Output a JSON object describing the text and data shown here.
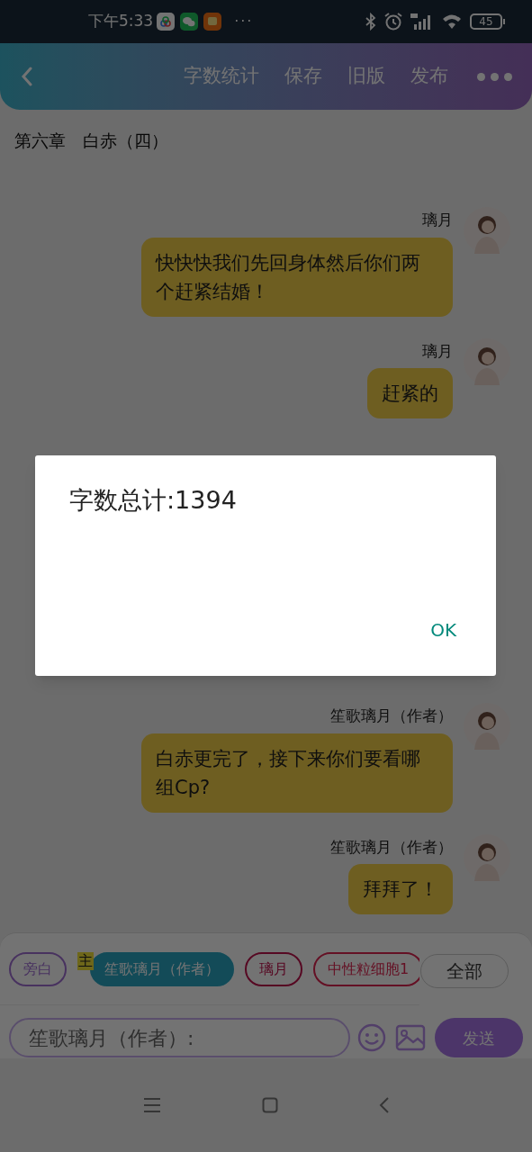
{
  "status_bar": {
    "time": "下午5:33",
    "more": "···",
    "battery": "45"
  },
  "header": {
    "actions": [
      {
        "label": "字数统计"
      },
      {
        "label": "保存"
      },
      {
        "label": "旧版"
      },
      {
        "label": "发布"
      }
    ]
  },
  "chapter_title": "第六章　白赤（四）",
  "messages": [
    {
      "sender": "璃月",
      "text": "快快快我们先回身体然后你们两个赶紧结婚！"
    },
    {
      "sender": "璃月",
      "text": "赶紧的"
    },
    {
      "sender": "笙歌璃月（作者）",
      "text": "白赤更完了，接下来你们要看哪组Cp?"
    },
    {
      "sender": "笙歌璃月（作者）",
      "text": "拜拜了！"
    }
  ],
  "roles": [
    {
      "label": "旁白",
      "selected": false,
      "main": false,
      "color": "#48325f"
    },
    {
      "label": "笙歌璃月（作者）",
      "selected": true,
      "main": true,
      "color": "#134b58"
    },
    {
      "label": "璃月",
      "selected": false,
      "main": false,
      "color": "#560822"
    },
    {
      "label": "中性粒细胞1",
      "selected": false,
      "main": false,
      "color": "#641024"
    }
  ],
  "main_badge": "主",
  "all_button": "全部",
  "input": {
    "placeholder": "笙歌璃月（作者）:"
  },
  "send_button": "发送",
  "dialog": {
    "message": "字数总计:1394",
    "button": "OK"
  }
}
